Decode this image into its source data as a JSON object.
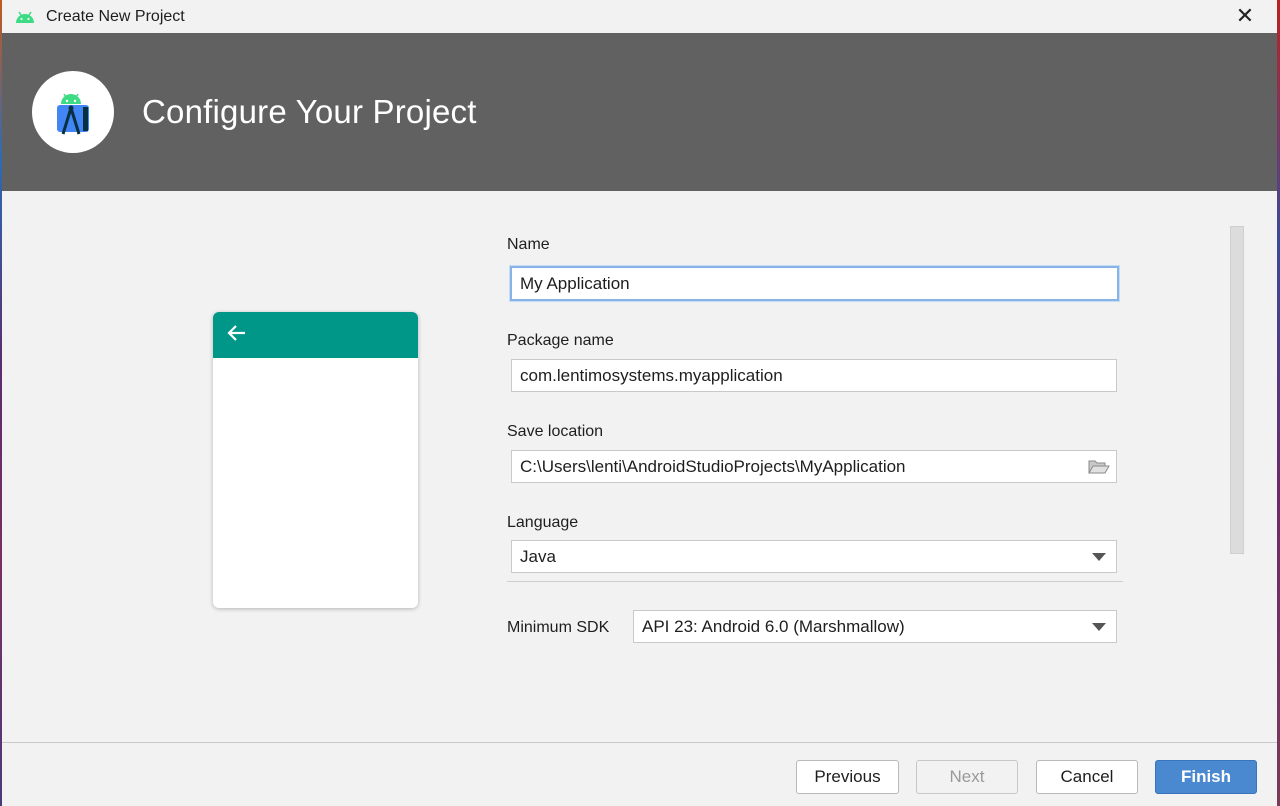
{
  "window": {
    "title": "Create New Project",
    "close_glyph": "✕"
  },
  "header": {
    "title": "Configure Your Project",
    "logo_icon": "android-studio-logo-icon"
  },
  "preview": {
    "accent_color": "#009688",
    "back_icon": "arrow-left-icon"
  },
  "form": {
    "name": {
      "label": "Name",
      "value": "My Application"
    },
    "package": {
      "label": "Package name",
      "value": "com.lentimosystems.myapplication"
    },
    "location": {
      "label": "Save location",
      "value": "C:\\Users\\lenti\\AndroidStudioProjects\\MyApplication",
      "button_icon": "folder-open-icon"
    },
    "language": {
      "label": "Language",
      "value": "Java"
    },
    "min_sdk": {
      "label": "Minimum SDK",
      "value": "API 23: Android 6.0 (Marshmallow)"
    }
  },
  "footer": {
    "previous": "Previous",
    "next": "Next",
    "cancel": "Cancel",
    "finish": "Finish"
  },
  "colors": {
    "header_bg": "#616161",
    "primary_button": "#4a88d0",
    "focus_border": "#87b3e6"
  }
}
